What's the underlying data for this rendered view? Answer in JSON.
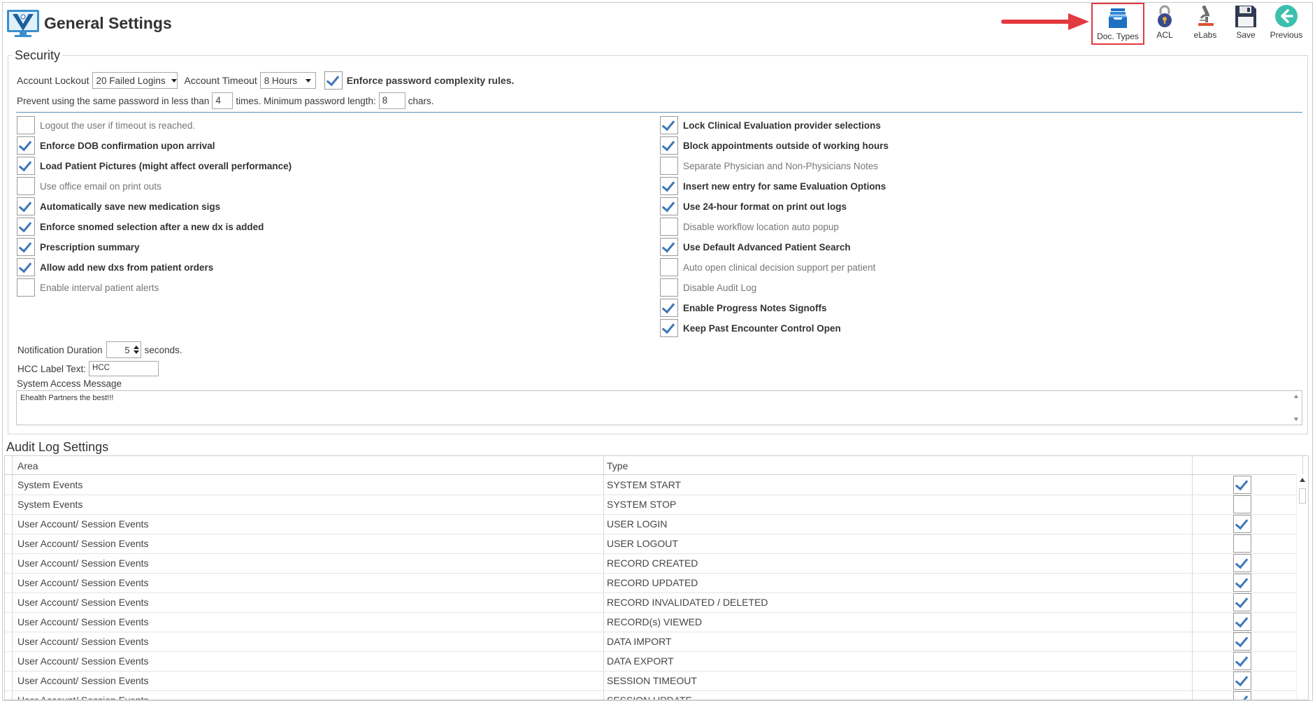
{
  "header": {
    "title": "General Settings"
  },
  "toolbar": [
    {
      "key": "doc_types",
      "label": "Doc. Types",
      "icon": "doc-types-icon",
      "highlighted": true
    },
    {
      "key": "acl",
      "label": "ACL",
      "icon": "lock-icon"
    },
    {
      "key": "elabs",
      "label": "eLabs",
      "icon": "microscope-icon"
    },
    {
      "key": "save",
      "label": "Save",
      "icon": "floppy-disk-icon"
    },
    {
      "key": "previous",
      "label": "Previous",
      "icon": "back-arrow-icon"
    }
  ],
  "colors": {
    "accent": "#3d78b8",
    "highlight_border": "#e23a3f",
    "arrow": "#e23a3f",
    "rule": "#5b8fb5"
  },
  "security": {
    "legend": "Security",
    "account_lockout_label": "Account Lockout",
    "account_lockout_value": "20 Failed Logins",
    "account_timeout_label": "Account Timeout",
    "account_timeout_value": "8 Hours",
    "password_complexity_label": "Enforce password complexity rules.",
    "password_complexity_checked": true,
    "reuse_prefix": "Prevent using the same password in less than",
    "reuse_value": "4",
    "reuse_suffix": "times. Minimum password length:",
    "min_length_value": "8",
    "min_length_suffix": "chars.",
    "left_options": [
      {
        "label": "Logout the user if timeout is reached.",
        "checked": false
      },
      {
        "label": "Enforce DOB confirmation upon arrival",
        "checked": true
      },
      {
        "label": "Load Patient Pictures (might affect overall performance)",
        "checked": true
      },
      {
        "label": "Use office email on print outs",
        "checked": false
      },
      {
        "label": "Automatically save new medication sigs",
        "checked": true
      },
      {
        "label": "Enforce snomed selection after a new dx is added",
        "checked": true
      },
      {
        "label": "Prescription summary",
        "checked": true
      },
      {
        "label": "Allow add new dxs from patient orders",
        "checked": true
      },
      {
        "label": "Enable interval patient alerts",
        "checked": false
      }
    ],
    "right_options": [
      {
        "label": "Lock Clinical Evaluation provider selections",
        "checked": true
      },
      {
        "label": "Block appointments outside of working hours",
        "checked": true
      },
      {
        "label": "Separate Physician and Non-Physicians Notes",
        "checked": false
      },
      {
        "label": "Insert new entry for same Evaluation Options",
        "checked": true
      },
      {
        "label": "Use 24-hour format on print out logs",
        "checked": true
      },
      {
        "label": "Disable workflow location auto popup",
        "checked": false
      },
      {
        "label": "Use Default Advanced Patient Search",
        "checked": true
      },
      {
        "label": "Auto open clinical decision support per patient",
        "checked": false
      },
      {
        "label": "Disable Audit Log",
        "checked": false
      },
      {
        "label": "Enable Progress Notes Signoffs",
        "checked": true
      },
      {
        "label": "Keep Past Encounter Control Open",
        "checked": true
      }
    ],
    "notification_label": "Notification Duration",
    "notification_value": "5",
    "notification_suffix": "seconds.",
    "hcc_label": "HCC Label Text:",
    "hcc_value": "HCC",
    "system_access_label": "System Access Message",
    "system_access_value": "Ehealth Partners the best!!!"
  },
  "audit": {
    "title": "Audit Log Settings",
    "columns": [
      "Area",
      "Type"
    ],
    "rows": [
      {
        "area": "System Events",
        "type": "SYSTEM START",
        "checked": true
      },
      {
        "area": "System Events",
        "type": "SYSTEM STOP",
        "checked": false
      },
      {
        "area": "User Account/ Session Events",
        "type": "USER LOGIN",
        "checked": true
      },
      {
        "area": "User Account/ Session Events",
        "type": "USER LOGOUT",
        "checked": false
      },
      {
        "area": "User Account/ Session Events",
        "type": "RECORD CREATED",
        "checked": true
      },
      {
        "area": "User Account/ Session Events",
        "type": "RECORD UPDATED",
        "checked": true
      },
      {
        "area": "User Account/ Session Events",
        "type": "RECORD INVALIDATED / DELETED",
        "checked": true
      },
      {
        "area": "User Account/ Session Events",
        "type": "RECORD(s) VIEWED",
        "checked": true
      },
      {
        "area": "User Account/ Session Events",
        "type": "DATA IMPORT",
        "checked": true
      },
      {
        "area": "User Account/ Session Events",
        "type": "DATA EXPORT",
        "checked": true
      },
      {
        "area": "User Account/ Session Events",
        "type": "SESSION TIMEOUT",
        "checked": true
      },
      {
        "area": "User Account/ Session Events",
        "type": "SESSION UPDATE",
        "checked": true
      }
    ]
  }
}
